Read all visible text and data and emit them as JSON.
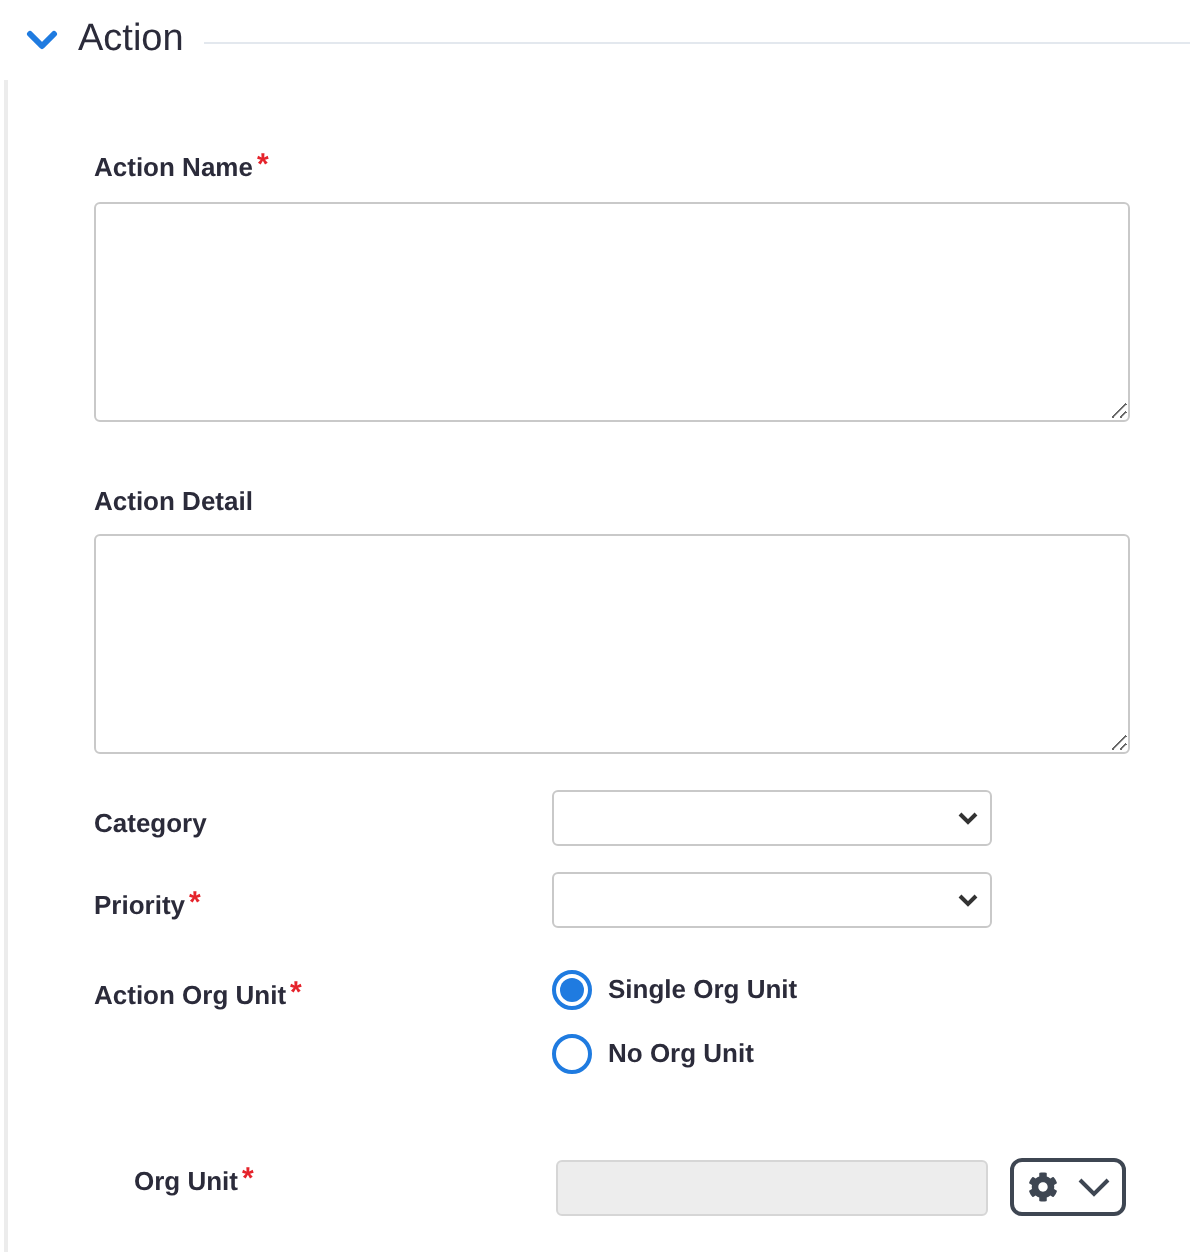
{
  "section": {
    "title": "Action",
    "expanded": true
  },
  "text_fields": [
    {
      "label": "Action Name",
      "required_mark": "*"
    },
    {
      "label": "Action Detail"
    }
  ],
  "select_fields": [
    {
      "label": "Category"
    },
    {
      "label": "Priority",
      "required_mark": "*"
    }
  ],
  "org_unit_choice": {
    "label": "Action Org Unit",
    "required_mark": "*",
    "options": [
      {
        "label": "Single Org Unit",
        "selected": true
      },
      {
        "label": "No Org Unit",
        "selected": false
      }
    ]
  },
  "org_unit": {
    "label": "Org Unit",
    "required_mark": "*",
    "disabled": true
  }
}
